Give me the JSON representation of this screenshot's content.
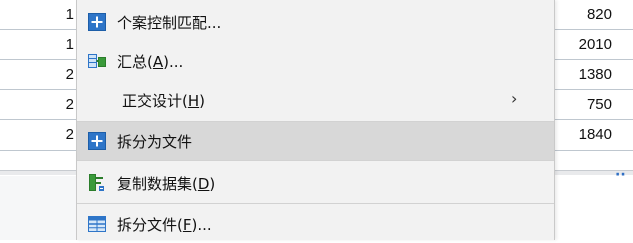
{
  "grid": {
    "rows": [
      {
        "left": "1",
        "right": "820"
      },
      {
        "left": "1",
        "right": "2010"
      },
      {
        "left": "2",
        "right": "1380"
      },
      {
        "left": "2",
        "right": "750"
      },
      {
        "left": "2",
        "right": "1840"
      }
    ]
  },
  "menu": {
    "items": [
      {
        "label": "个案控制匹配...",
        "icon": "plus-square-icon"
      },
      {
        "label": "汇总(",
        "mnemonic": "A",
        "suffix": ")...",
        "icon": "aggregate-icon"
      },
      {
        "label": "正交设计(",
        "mnemonic": "H",
        "suffix": ")",
        "submenu": "›"
      },
      {
        "label": "拆分为文件",
        "icon": "plus-square-icon"
      },
      {
        "label": "复制数据集(",
        "mnemonic": "D",
        "suffix": ")",
        "icon": "copy-dataset-icon"
      },
      {
        "label": "拆分文件(",
        "mnemonic": "F",
        "suffix": ")...",
        "icon": "split-file-icon"
      }
    ]
  },
  "colors": {
    "icon_blue": "#2e75c8",
    "icon_green": "#3a9a3a",
    "selected_bg": "#d8d8d8",
    "menu_bg": "#f2f2f2"
  }
}
